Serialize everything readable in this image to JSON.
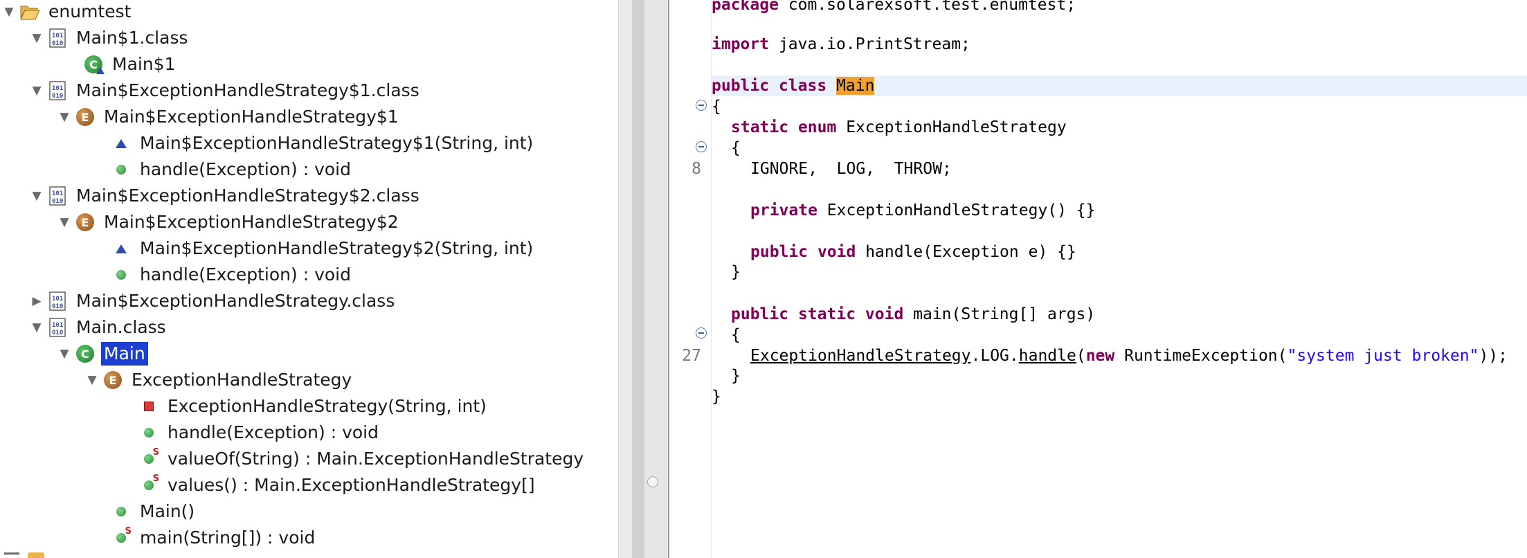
{
  "tree": {
    "rows": [
      {
        "label": "enumtest",
        "icon": "folder-open-icon",
        "expanded": true
      },
      {
        "label": "Main$1.class",
        "icon": "class-file-icon",
        "expanded": true
      },
      {
        "label": "Main$1",
        "icon": "class-icon"
      },
      {
        "label": "Main$ExceptionHandleStrategy$1.class",
        "icon": "class-file-icon",
        "expanded": true
      },
      {
        "label": "Main$ExceptionHandleStrategy$1",
        "icon": "enum-icon",
        "expanded": true
      },
      {
        "label": "Main$ExceptionHandleStrategy$1(String, int)",
        "icon": "constructor-icon"
      },
      {
        "label": "handle(Exception) : void",
        "icon": "public-method-icon"
      },
      {
        "label": "Main$ExceptionHandleStrategy$2.class",
        "icon": "class-file-icon",
        "expanded": true
      },
      {
        "label": "Main$ExceptionHandleStrategy$2",
        "icon": "enum-icon",
        "expanded": true
      },
      {
        "label": "Main$ExceptionHandleStrategy$2(String, int)",
        "icon": "constructor-icon"
      },
      {
        "label": "handle(Exception) : void",
        "icon": "public-method-icon"
      },
      {
        "label": "Main$ExceptionHandleStrategy.class",
        "icon": "class-file-icon",
        "expanded": false
      },
      {
        "label": "Main.class",
        "icon": "class-file-icon",
        "expanded": true
      },
      {
        "label": "Main",
        "icon": "class-icon",
        "expanded": true,
        "selected": true
      },
      {
        "label": "ExceptionHandleStrategy",
        "icon": "enum-icon",
        "expanded": true
      },
      {
        "label": "ExceptionHandleStrategy(String, int)",
        "icon": "private-method-icon"
      },
      {
        "label": "handle(Exception) : void",
        "icon": "public-method-icon"
      },
      {
        "label": "valueOf(String) : Main.ExceptionHandleStrategy",
        "icon": "static-method-icon"
      },
      {
        "label": "values() : Main.ExceptionHandleStrategy[]",
        "icon": "static-method-icon"
      },
      {
        "label": "Main()",
        "icon": "public-method-icon"
      },
      {
        "label": "main(String[]) : void",
        "icon": "static-method-icon"
      }
    ]
  },
  "editor": {
    "line_numbers": {
      "l8": "8",
      "l27": "27"
    },
    "code": {
      "pkg_kw": "package",
      "pkg_name": " com.solarexsoft.test.enumtest;",
      "import_kw": "import",
      "import_name": " java.io.PrintStream;",
      "pc_public": "public",
      "pc_class": "class",
      "pc_name": "Main",
      "brace_open": "{",
      "enum_static": "static",
      "enum_kw": "enum",
      "enum_name": " ExceptionHandleStrategy",
      "brace_open_inner": "{",
      "constants": "IGNORE,  LOG,  THROW;",
      "ctor_private": "private",
      "ctor_rest": " ExceptionHandleStrategy() {}",
      "h_public": "public",
      "h_void": "void",
      "h_rest": " handle(Exception e) {}",
      "brace_close_inner": "}",
      "m_public": "public",
      "m_static": "static",
      "m_void": "void",
      "m_rest": " main(String[] args)",
      "brace_open_main": "{",
      "call_ehs": "ExceptionHandleStrategy",
      "call_log": ".LOG.",
      "call_handle": "handle",
      "call_paren": "(",
      "call_new": "new",
      "call_re": " RuntimeException(",
      "call_str": "\"system just broken\"",
      "call_end": "));",
      "brace_close_main": "}",
      "brace_close": "}"
    }
  }
}
